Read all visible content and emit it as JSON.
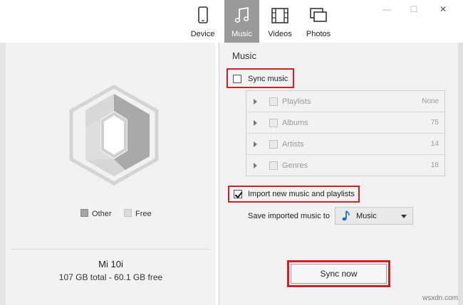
{
  "tabs": [
    {
      "label": "Device",
      "icon": "phone-icon",
      "active": false
    },
    {
      "label": "Music",
      "icon": "music-note-icon",
      "active": true
    },
    {
      "label": "Videos",
      "icon": "film-icon",
      "active": false
    },
    {
      "label": "Photos",
      "icon": "photos-icon",
      "active": false
    }
  ],
  "window": {
    "minimize": "—",
    "maximize": "☐",
    "close": "✕"
  },
  "storage": {
    "legend_other": "Other",
    "legend_free": "Free",
    "device_name": "Mi 10i",
    "summary": "107 GB total - 60.1 GB free",
    "colors": {
      "other": "#a6a6a6",
      "free": "#dcdcdc",
      "outline": "#d0d0d0"
    }
  },
  "music": {
    "title": "Music",
    "sync_music_label": "Sync music",
    "sync_music_checked": false,
    "categories": [
      {
        "label": "Playlists",
        "count": "None"
      },
      {
        "label": "Albums",
        "count": "75"
      },
      {
        "label": "Artists",
        "count": "14"
      },
      {
        "label": "Genres",
        "count": "18"
      }
    ],
    "import_label": "Import new music and playlists",
    "import_checked": true,
    "save_to_label": "Save imported music to",
    "save_to_value": "Music",
    "sync_now_label": "Sync now"
  },
  "accent": {
    "highlight": "#d21e26",
    "active_tab": "#9a9a9a"
  },
  "watermark": "wsxdn.com"
}
